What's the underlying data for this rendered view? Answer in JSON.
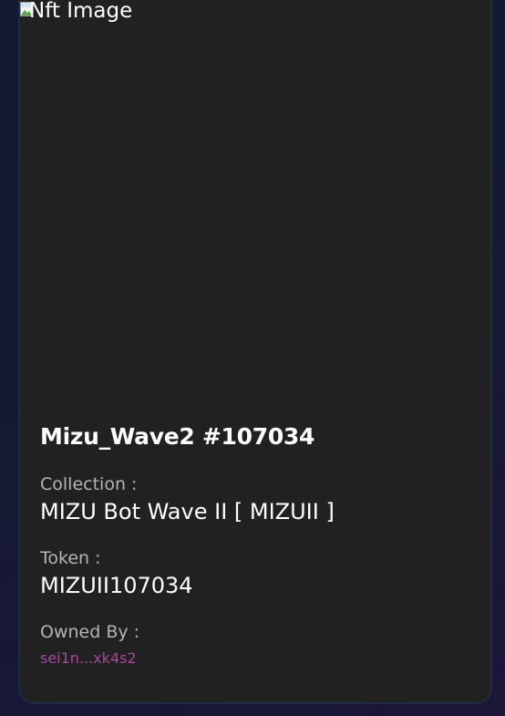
{
  "nft": {
    "image_alt": "Nft Image",
    "name": "Mizu_Wave2 #107034",
    "collection_label": "Collection :",
    "collection_value": "MIZU Bot Wave II [ MIZUII ]",
    "token_label": "Token :",
    "token_value": "MIZUII107034",
    "owner_label": "Owned By :",
    "owner_value": "sei1n...xk4s2"
  },
  "colors": {
    "card_bg": "#212121",
    "card_border": "#1f2a44",
    "page_bg": "#151a32",
    "owner_link": "#a64a9c",
    "label_text": "#b4b4b4",
    "value_text": "#ffffff"
  },
  "icons": {
    "broken_image": "broken-image-icon"
  }
}
